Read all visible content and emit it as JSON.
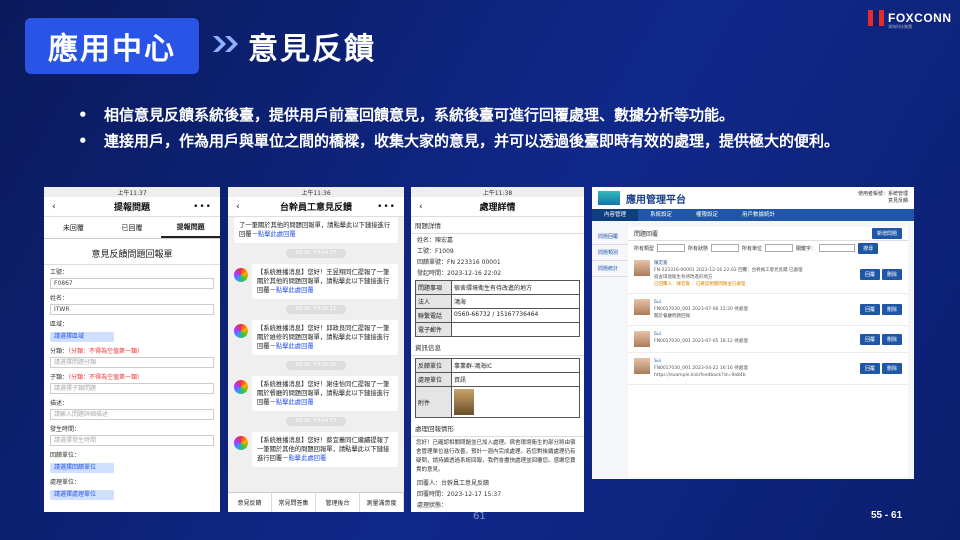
{
  "header": {
    "section_tag": "應用中心",
    "title": "意見反饋",
    "brand": "FOXCONN",
    "brand_sub": "鴻海科技集團"
  },
  "bullets": [
    "相信意見反饋系統後臺，提供用戶前臺回饋意見，系統後臺可進行回覆處理、數據分析等功能。",
    "連接用戶，作為用戶與單位之間的橋樑，收集大家的意見，并可以透過後臺即時有效的處理，提供極大的便利。"
  ],
  "bullet_symbol": "•",
  "phone1": {
    "status": "上午11:37",
    "nav_title": "提報問題",
    "tabs": [
      "未回覆",
      "已回覆",
      "提報問題"
    ],
    "form_title": "意見反饋問題回報單",
    "fields": [
      {
        "label": "工號：",
        "value": "F0867"
      },
      {
        "label": "姓名：",
        "value": "ITWR"
      }
    ],
    "unit_label": "區域：",
    "unit_value": "請選擇區域",
    "category_label": "分類：",
    "category_hint": "（分類：不得為空值第一類）",
    "category_placeholder": "請選擇問題分類",
    "subcat_label": "子類：",
    "subcat_hint": "（分類：不得為空值第一類）",
    "subcat_placeholder": "請選擇子類問題",
    "desc_label": "描述：",
    "desc_placeholder": "請輸入問題詳細描述",
    "time_label": "發生時間：",
    "time_placeholder": "請選擇發生時間",
    "feedback_unit_label": "回饋單位：",
    "feedback_unit_value": "請選擇回饋單位",
    "feedback_dept_label": "處理單位：",
    "feedback_dept_value": "請選擇處理單位"
  },
  "phone2": {
    "status": "上午11:36",
    "nav_title": "台幹員工意見反饋",
    "time_pills": [
      "09-30 下午04:37",
      "09-30 下午05:11",
      "09-30 下午05:35",
      "09-30 下午04:57"
    ],
    "messages": [
      {
        "text": "了一筆關於其他的問題回報單，請點擊此以下鏈接進行回覆－",
        "link": "點擊此處回覆"
      },
      {
        "text": "【系統推播消息】您好！王昱翔同仁提報了一筆關於其他的問題回報單，請點擊此以下鏈接進行回覆－",
        "link": "點擊此處回覆"
      },
      {
        "text": "【系統推播消息】您好！邱政良同仁提報了一筆關於維修的問題回報單，請點擊此以下鏈接進行回覆－",
        "link": "點擊此處回覆"
      },
      {
        "text": "【系統推播消息】您好！謝佳怡同仁提報了一筆關於餐廳的問題回報單，請點擊此以下鏈接進行回覆－",
        "link": "點擊此處回覆"
      },
      {
        "text": "【系統推播消息】您好！蔡宜蓁同仁繼續提報了一筆關於其他的問題回報單，請點擊此以下鏈接進行回覆－",
        "link": "點擊此處回覆"
      }
    ],
    "bottom_nav": [
      "意見反饋",
      "常見問答集",
      "管理後台",
      "測量滿意度"
    ]
  },
  "phone3": {
    "status": "上午11:38",
    "nav_title": "處理詳情",
    "section1": "問題詳情",
    "kv": [
      "姓名：陳宏嘉",
      "工號：F1009",
      "回饋單號：FN 223316 00001",
      "發起時間：2023-12-16 22:02"
    ],
    "grid1": [
      {
        "k": "問題事項",
        "v": "宿舍環境衛生有待改進的地方"
      },
      {
        "k": "法人",
        "v": "鴻海"
      },
      {
        "k": "聯繫電話",
        "v": "0560-66732 / 15167736464"
      },
      {
        "k": "電子郵件",
        "v": ""
      }
    ],
    "section2": "資訊信息",
    "grid2": [
      {
        "k": "反饋單位",
        "v": "事業群-鴻海IC"
      },
      {
        "k": "處理單位",
        "v": "資訊"
      },
      {
        "k": "附件",
        "v": ""
      }
    ],
    "section3": "處理回報情形",
    "para": "您好！已確認相關問題並已加入處理。宿舍環境衛生的部分將由宿舍管理單位進行改善，預計一週內完成處理。若您對後續處理仍有疑問，請持續透過系統回報，我們會盡快處理並回覆您。感謝您寶貴的意見。",
    "footer1": "回覆人：台幹員工意見反饋",
    "footer2": "回覆時間：2023-12-17 15:37",
    "footer3": "處理狀態："
  },
  "web": {
    "brand": "應用管理平台",
    "user_lines": [
      "使用者帳號：系統管理",
      "意見反饋"
    ],
    "nav": [
      "內容管理",
      "系統設定",
      "權限設定",
      "用戶數據統計"
    ],
    "side": [
      "問題回覆",
      "問題類別",
      "問題統計"
    ],
    "list_title": "問題回覆",
    "new_button": "新增問題",
    "filters": [
      "所有類型",
      "所有狀態",
      "所有單位"
    ],
    "keyword_label": "關鍵字：",
    "search_button": "搜尋",
    "items": [
      {
        "name": "陳宏嘉",
        "meta": "FN-223316-00001  2023-12-16 22:02  回覆：台幹員工意見反饋  已處理",
        "reply": "宿舍環境衛生有待改進的地方",
        "answer": "已回覆人：陳宏嘉 ：已確認相關問題並已處理",
        "btns": [
          "回覆",
          "刪除"
        ]
      },
      {
        "name": "Sui",
        "meta": "FN0017030_001  2023-07-06 15:20  待處理",
        "reply": "關於餐廳問題回報",
        "answer": "",
        "btns": [
          "回覆",
          "刪除"
        ]
      },
      {
        "name": "Sui",
        "meta": "FN0017030_001  2023-07-05 18:12  待處理",
        "reply": "",
        "answer": "",
        "btns": [
          "回覆",
          "刪除"
        ]
      },
      {
        "name": "Sui",
        "meta": "FN0017030_001  2023-04-22 16:16  待處理",
        "reply": "https://example.link/feedback?id=9a84b",
        "answer": "",
        "btns": [
          "回覆",
          "刪除"
        ]
      }
    ]
  },
  "footer": {
    "center_num": "61",
    "page": "55 - 61"
  }
}
